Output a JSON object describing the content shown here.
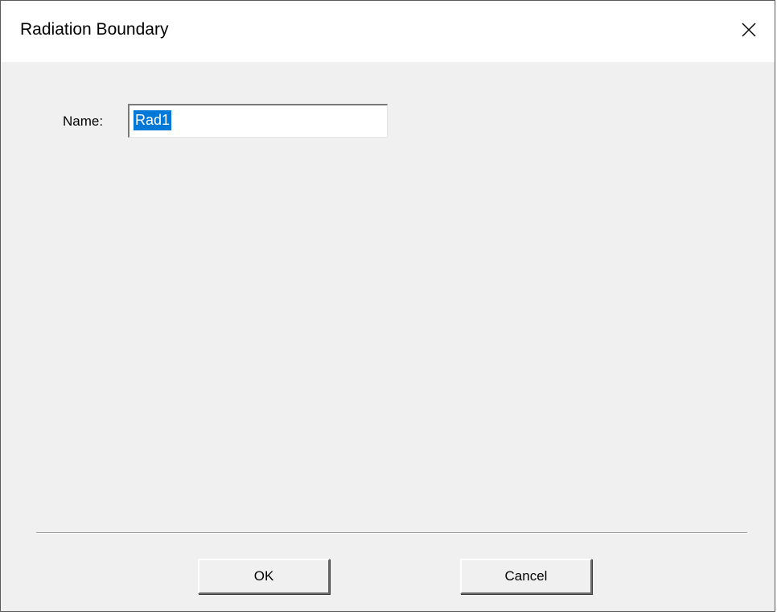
{
  "window": {
    "title": "Radiation Boundary"
  },
  "form": {
    "name_label": "Name:",
    "name_value": "Rad1"
  },
  "buttons": {
    "ok_label": "OK",
    "cancel_label": "Cancel"
  },
  "icons": {
    "close": "close-icon"
  },
  "colors": {
    "selection": "#0078d7",
    "dialog_bg": "#f0f0f0",
    "titlebar_bg": "#ffffff"
  }
}
